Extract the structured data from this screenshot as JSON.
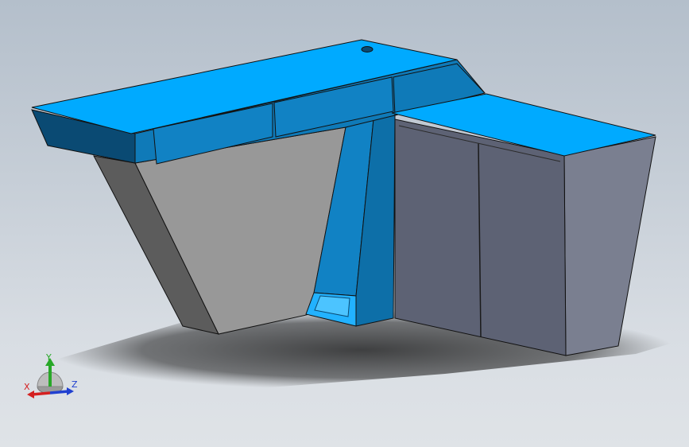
{
  "triad": {
    "x_label": "X",
    "y_label": "Y",
    "z_label": "Z",
    "x_color": "#d42020",
    "y_color": "#28a828",
    "z_color": "#2040d0"
  },
  "model": {
    "top_color": "#00aaff",
    "front_blue": "#0f7ab8",
    "dark_blue": "#0a4a73",
    "panel_gray": "#989898",
    "side_gray": "#5c5c5c",
    "cabinet_front": "#5d6274",
    "cabinet_side": "#7a7f90"
  }
}
